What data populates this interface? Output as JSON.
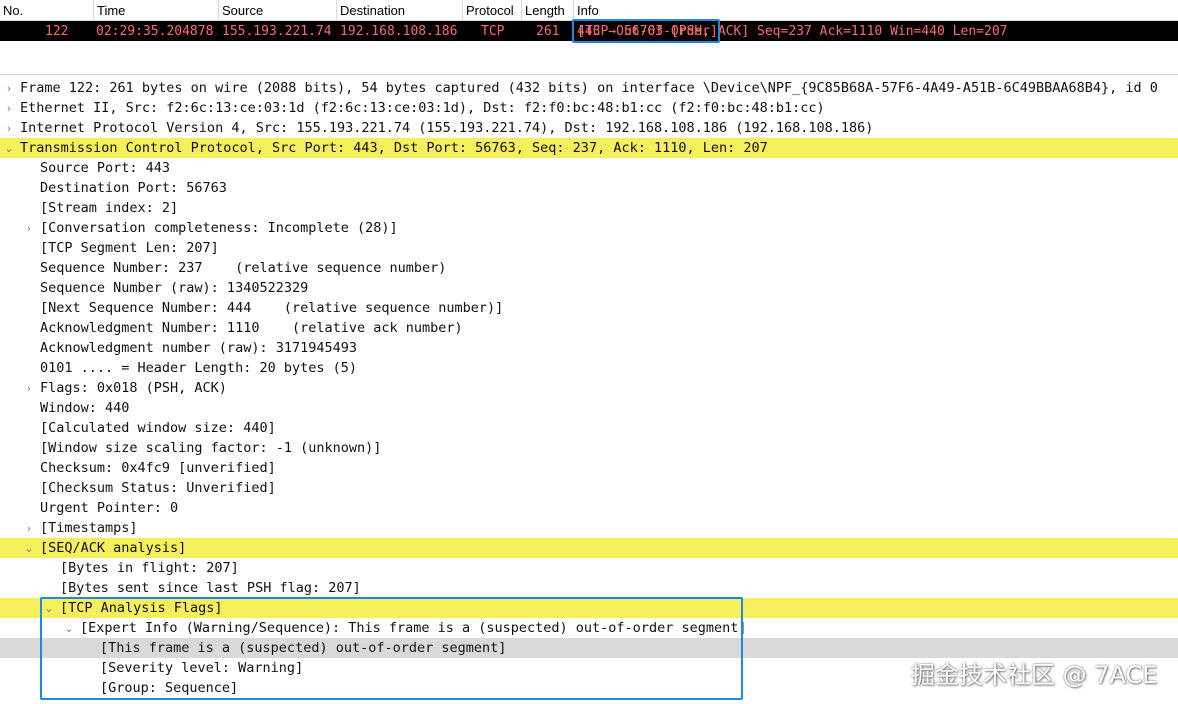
{
  "packet_list": {
    "columns": [
      "No.",
      "Time",
      "Source",
      "Destination",
      "Protocol",
      "Length",
      "Info"
    ],
    "row": {
      "no": "122",
      "time": "02:29:35.204878",
      "source": "155.193.221.74",
      "destination": "192.168.108.186",
      "protocol": "TCP",
      "length": "261",
      "info_flag": "[TCP Out-Of-Order]",
      "info_rest": " 443 → 56763 [PSH, ACK] Seq=237 Ack=1110 Win=440 Len=207"
    }
  },
  "details": [
    {
      "text": "Frame 122: 261 bytes on wire (2088 bits), 54 bytes captured (432 bits) on interface \\Device\\NPF_{9C85B68A-57F6-4A49-A51B-6C49BBAA68B4}, id 0",
      "arrow": "›"
    },
    {
      "text": "Ethernet II, Src: f2:6c:13:ce:03:1d (f2:6c:13:ce:03:1d), Dst: f2:f0:bc:48:b1:cc (f2:f0:bc:48:b1:cc)",
      "arrow": "›"
    },
    {
      "text": "Internet Protocol Version 4, Src: 155.193.221.74 (155.193.221.74), Dst: 192.168.108.186 (192.168.108.186)",
      "arrow": "›"
    },
    {
      "text": "Transmission Control Protocol, Src Port: 443, Dst Port: 56763, Seq: 237, Ack: 1110, Len: 207",
      "arrow": "⌄"
    },
    {
      "text": "Source Port: 443",
      "arrow": ""
    },
    {
      "text": "Destination Port: 56763",
      "arrow": ""
    },
    {
      "text": "[Stream index: 2]",
      "arrow": ""
    },
    {
      "text": "[Conversation completeness: Incomplete (28)]",
      "arrow": "›"
    },
    {
      "text": "[TCP Segment Len: 207]",
      "arrow": ""
    },
    {
      "text": "Sequence Number: 237    (relative sequence number)",
      "arrow": ""
    },
    {
      "text": "Sequence Number (raw): 1340522329",
      "arrow": ""
    },
    {
      "text": "[Next Sequence Number: 444    (relative sequence number)]",
      "arrow": ""
    },
    {
      "text": "Acknowledgment Number: 1110    (relative ack number)",
      "arrow": ""
    },
    {
      "text": "Acknowledgment number (raw): 3171945493",
      "arrow": ""
    },
    {
      "text": "0101 .... = Header Length: 20 bytes (5)",
      "arrow": ""
    },
    {
      "text": "Flags: 0x018 (PSH, ACK)",
      "arrow": "›"
    },
    {
      "text": "Window: 440",
      "arrow": ""
    },
    {
      "text": "[Calculated window size: 440]",
      "arrow": ""
    },
    {
      "text": "[Window size scaling factor: -1 (unknown)]",
      "arrow": ""
    },
    {
      "text": "Checksum: 0x4fc9 [unverified]",
      "arrow": ""
    },
    {
      "text": "[Checksum Status: Unverified]",
      "arrow": ""
    },
    {
      "text": "Urgent Pointer: 0",
      "arrow": ""
    },
    {
      "text": "[Timestamps]",
      "arrow": "›"
    },
    {
      "text": "[SEQ/ACK analysis]",
      "arrow": "⌄"
    },
    {
      "text": "[Bytes in flight: 207]",
      "arrow": ""
    },
    {
      "text": "[Bytes sent since last PSH flag: 207]",
      "arrow": ""
    },
    {
      "text": "[TCP Analysis Flags]",
      "arrow": "⌄"
    },
    {
      "text": "[Expert Info (Warning/Sequence): This frame is a (suspected) out-of-order segment]",
      "arrow": "⌄"
    },
    {
      "text": "[This frame is a (suspected) out-of-order segment]",
      "arrow": ""
    },
    {
      "text": "[Severity level: Warning]",
      "arrow": ""
    },
    {
      "text": "[Group: Sequence]",
      "arrow": ""
    }
  ],
  "watermark": "掘金技术社区 @ 7ACE",
  "colors": {
    "highlight": "#f5ef5b",
    "selected": "#d9d9d9",
    "packet_row_bg": "#000000",
    "packet_row_fg": "#ff6b6b",
    "annotation_box": "#1e88e5"
  }
}
